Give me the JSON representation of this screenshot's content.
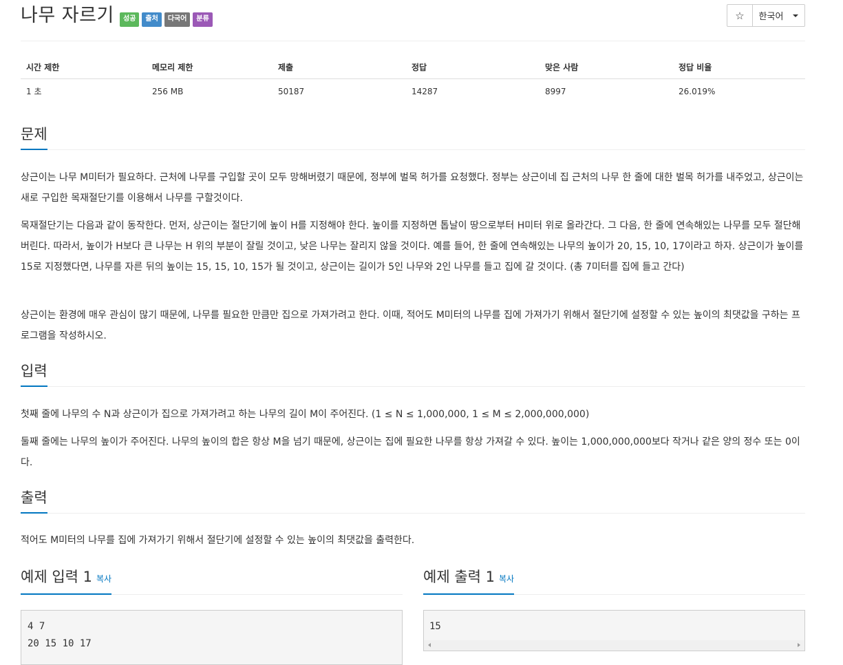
{
  "problem": {
    "title": "나무 자르기",
    "labels": [
      {
        "text": "성공",
        "color": "#5cb85c"
      },
      {
        "text": "출처",
        "color": "#428bca"
      },
      {
        "text": "다국어",
        "color": "#777777"
      },
      {
        "text": "분류",
        "color": "#9b59b6"
      }
    ],
    "star_icon": "star-outline-icon",
    "star_glyph": "☆",
    "language": "한국어"
  },
  "stats": {
    "headers": [
      "시간 제한",
      "메모리 제한",
      "제출",
      "정답",
      "맞은 사람",
      "정답 비율"
    ],
    "values": [
      "1 초",
      "256 MB",
      "50187",
      "14287",
      "8997",
      "26.019%"
    ]
  },
  "sections": {
    "problem_heading": "문제",
    "problem_paragraphs": [
      "상근이는 나무 M미터가 필요하다. 근처에 나무를 구입할 곳이 모두 망해버렸기 때문에, 정부에 벌목 허가를 요청했다. 정부는 상근이네 집 근처의 나무 한 줄에 대한 벌목 허가를 내주었고, 상근이는 새로 구입한 목재절단기를 이용해서 나무를 구할것이다.",
      "목재절단기는 다음과 같이 동작한다. 먼저, 상근이는 절단기에 높이 H를 지정해야 한다. 높이를 지정하면 톱날이 땅으로부터 H미터 위로 올라간다. 그 다음, 한 줄에 연속해있는 나무를 모두 절단해버린다. 따라서, 높이가 H보다 큰 나무는 H 위의 부분이 잘릴 것이고, 낮은 나무는 잘리지 않을 것이다. 예를 들어, 한 줄에 연속해있는 나무의 높이가 20, 15, 10, 17이라고 하자. 상근이가 높이를 15로 지정했다면, 나무를 자른 뒤의 높이는 15, 15, 10, 15가 될 것이고, 상근이는 길이가 5인 나무와 2인 나무를 들고 집에 갈 것이다. (총 7미터를 집에 들고 간다)",
      "상근이는 환경에 매우 관심이 많기 때문에, 나무를 필요한 만큼만 집으로 가져가려고 한다. 이때, 적어도 M미터의 나무를 집에 가져가기 위해서 절단기에 설정할 수 있는 높이의 최댓값을 구하는 프로그램을 작성하시오."
    ],
    "input_heading": "입력",
    "input_paragraphs": [
      "첫째 줄에 나무의 수 N과 상근이가 집으로 가져가려고 하는 나무의 길이 M이 주어진다. (1 ≤ N ≤ 1,000,000, 1 ≤ M ≤ 2,000,000,000)",
      "둘째 줄에는 나무의 높이가 주어진다. 나무의 높이의 합은 항상 M을 넘기 때문에, 상근이는 집에 필요한 나무를 항상 가져갈 수 있다. 높이는 1,000,000,000보다 작거나 같은 양의 정수 또는 0이다."
    ],
    "output_heading": "출력",
    "output_paragraphs": [
      "적어도 M미터의 나무를 집에 가져가기 위해서 절단기에 설정할 수 있는 높이의 최댓값을 출력한다."
    ],
    "sample_input_heading": "예제 입력 1",
    "sample_output_heading": "예제 출력 1",
    "copy_label": "복사",
    "sample_input_lines": [
      "4 7",
      "20 15 10 17"
    ],
    "sample_output_lines": [
      "15"
    ]
  }
}
